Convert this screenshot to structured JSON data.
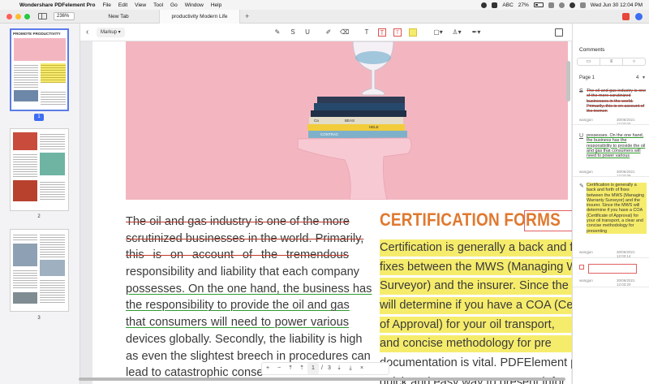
{
  "menubar": {
    "app_name": "Wondershare PDFelement Pro",
    "items": [
      "File",
      "Edit",
      "View",
      "Tool",
      "Go",
      "Window",
      "Help"
    ],
    "input_source": "ABC",
    "battery": "27%",
    "datetime": "Wed Jun 30  12:04 PM"
  },
  "tabbar": {
    "zoom": "236%",
    "tabs": [
      {
        "label": "New Tab"
      },
      {
        "label": "productivity Modern Life"
      }
    ],
    "add_tab": "+"
  },
  "thumbnails": {
    "pages": [
      {
        "number": "1",
        "title": "PROMOTE PRODUCTIVITY"
      },
      {
        "number": "2"
      },
      {
        "number": "3"
      }
    ]
  },
  "toolbar": {
    "markup_label": "Markup",
    "text_tool": "T"
  },
  "document": {
    "left_lines": [
      "The oil and gas industry is one of the more",
      "scrutinized businesses in the world. Primarily,",
      "this is on account of the tremendous",
      "responsibility and liability that each company",
      "possesses. On the one hand, the business has",
      "the responsibility to provide the oil and gas",
      "that consumers will need to power various",
      "devices globally. Secondly, the liability is high",
      "as even the slightest breech in procedures can",
      "lead to catastrophic conse"
    ],
    "right_title": "CERTIFICATION FORMS",
    "right_lines": [
      "Certification is generally a back and f",
      "fixes between the MWS (Managing W",
      "Surveyor) and the insurer. Since the",
      "will determine if you have a COA (Cer",
      "of Approval) for your oil transport,",
      "and concise methodology for pre",
      "documentation is vital. PDFElement p",
      "quick and easy way to present infor"
    ],
    "book_spines": [
      "Ca",
      "BEAS",
      "HELE",
      "CONTRAC"
    ]
  },
  "pagenav": {
    "plus": "+",
    "minus": "−",
    "current": "1",
    "sep": "/",
    "total": "3",
    "close": "×"
  },
  "comments": {
    "header": "Comments",
    "page_label": "Page 1",
    "count": "4",
    "items": [
      {
        "icon_text": "S",
        "text": "The oil and gas industry is one of the more scrutinized businesses in the world. Primarily, this is on account of the tremen",
        "author": "wangjun",
        "date": "30/06/2021 12:03:04"
      },
      {
        "icon_text": "U",
        "text": "possesses. On the one hand, the business has the responsibility to provide the oil and gas that consumers will need to power various",
        "author": "wangjun",
        "date": "30/06/2021 12:03:08"
      },
      {
        "icon_text": "",
        "text": "Certification is generally a back and forth of fixes between the MWS (Managing Warranty Surveyor) and the insurer. Since the MWS will determine if you have a COA (Certificate of Approval) for your oil transport, a clear and concise methodology for presenting",
        "author": "wangjun",
        "date": "30/06/2021 12:03:14"
      },
      {
        "icon_text": "",
        "text": "",
        "author": "wangjun",
        "date": "30/06/2021 12:03:20"
      }
    ]
  },
  "colors": {
    "accent": "#3d6df2",
    "highlight": "#f6ec6c",
    "strike": "#c0392b",
    "underline": "#2e9b2e",
    "title_orange": "#e0792f",
    "hero_pink": "#f3b6c0"
  }
}
